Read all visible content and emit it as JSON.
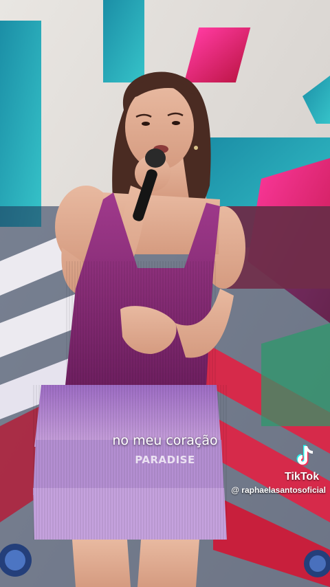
{
  "video": {
    "caption": "no meu coração",
    "brand_subtitle": "",
    "brand_name": "PARADISE"
  },
  "watermark": {
    "brand": "TikTok",
    "handle": "@ raphaelasantosoficial",
    "icon": "tiktok-logo-icon"
  },
  "colors": {
    "top_fringe": "#8a2a78",
    "skirt_fringe": "#b58fd0",
    "stage_magenta": "#e0205f",
    "stage_teal": "#2fb3c6"
  }
}
